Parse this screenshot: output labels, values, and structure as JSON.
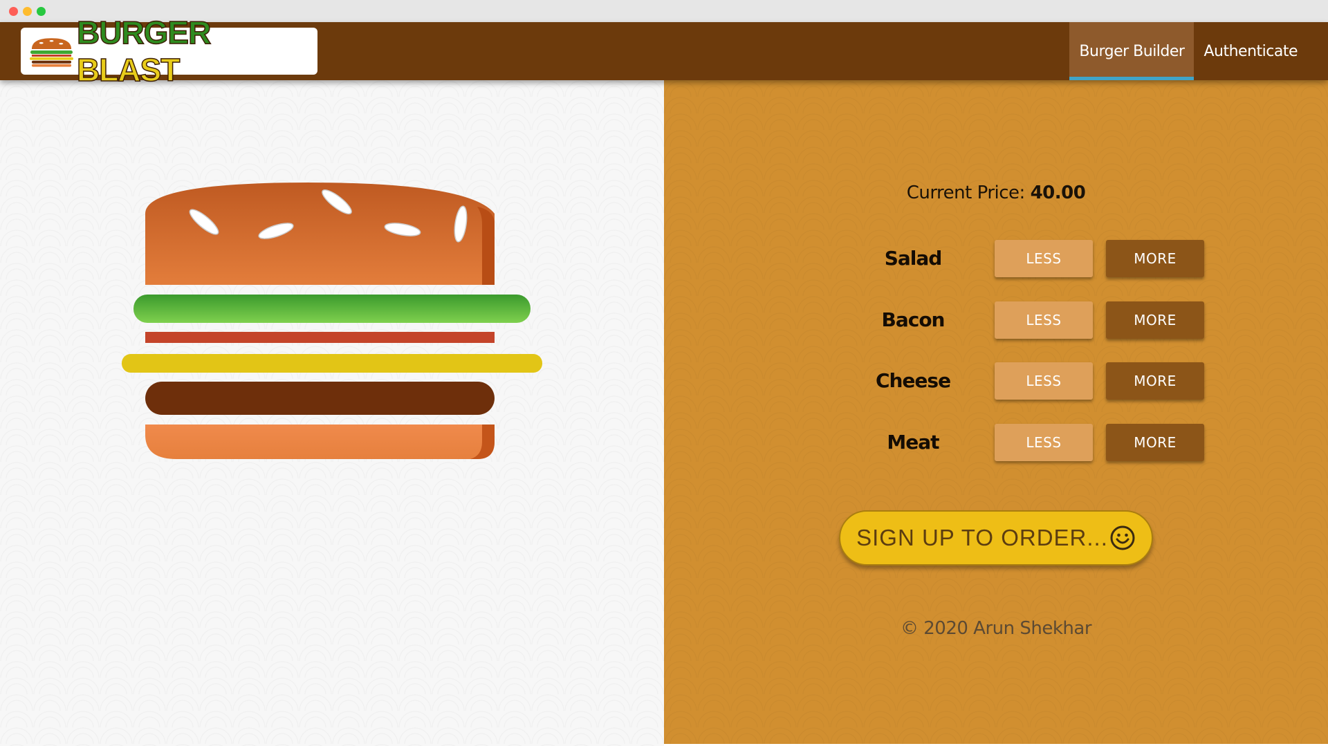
{
  "window": {
    "controls": [
      "close",
      "minimize",
      "maximize"
    ]
  },
  "nav": {
    "brand_word1": "BURGER",
    "brand_word2": "BLAST",
    "items": [
      {
        "label": "Burger Builder",
        "active": true
      },
      {
        "label": "Authenticate",
        "active": false
      }
    ]
  },
  "burger": {
    "layers": [
      "bread-top",
      "salad",
      "bacon",
      "cheese",
      "meat",
      "bread-bottom"
    ]
  },
  "build_controls": {
    "price_label": "Current Price:",
    "price_value": "40.00",
    "controls": [
      {
        "label": "Salad",
        "less": "LESS",
        "more": "MORE"
      },
      {
        "label": "Bacon",
        "less": "LESS",
        "more": "MORE"
      },
      {
        "label": "Cheese",
        "less": "LESS",
        "more": "MORE"
      },
      {
        "label": "Meat",
        "less": "LESS",
        "more": "MORE"
      }
    ],
    "order_button": "SIGN UP TO ORDER...",
    "order_icon": "smiley-icon"
  },
  "footer": {
    "text": "© 2020 Arun Shekhar"
  },
  "colors": {
    "navbar": "#6c3a0c",
    "nav_active": "#8e5a2c",
    "nav_active_underline": "#40a4c8",
    "panel": "#d18f30",
    "less_button": "#dea05a",
    "more_button": "#8c5518",
    "order_button": "#eebe16"
  }
}
